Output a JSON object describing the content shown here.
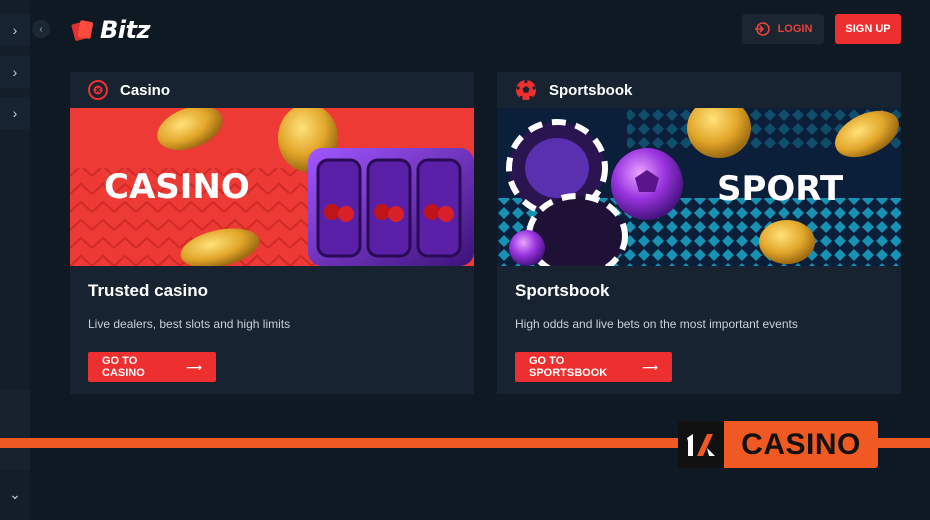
{
  "header": {
    "brand": "Bitz",
    "login_label": "LOGIN",
    "signup_label": "SIGN UP"
  },
  "sidebar": {
    "items": [
      {
        "icon": "chevron-right-icon"
      },
      {
        "icon": "chevron-right-icon"
      },
      {
        "icon": "chevron-right-icon"
      }
    ],
    "bottom_icon": "chevron-down-icon",
    "collapse_icon": "chevron-left-icon"
  },
  "cards": {
    "casino": {
      "header_label": "Casino",
      "banner_text": "CASINO",
      "title": "Trusted casino",
      "description": "Live dealers, best slots and high limits",
      "cta_label": "GO TO CASINO"
    },
    "sportsbook": {
      "header_label": "Sportsbook",
      "banner_text": "SPORT",
      "title": "Sportsbook",
      "description": "High odds and live bets on the most important events",
      "cta_label": "GO TO SPORTSBOOK"
    }
  },
  "watermark": {
    "text": "CASINO"
  },
  "colors": {
    "background": "#0f1923",
    "card": "#172330",
    "accent": "#ee2f2f",
    "watermark_orange": "#f05a22"
  }
}
